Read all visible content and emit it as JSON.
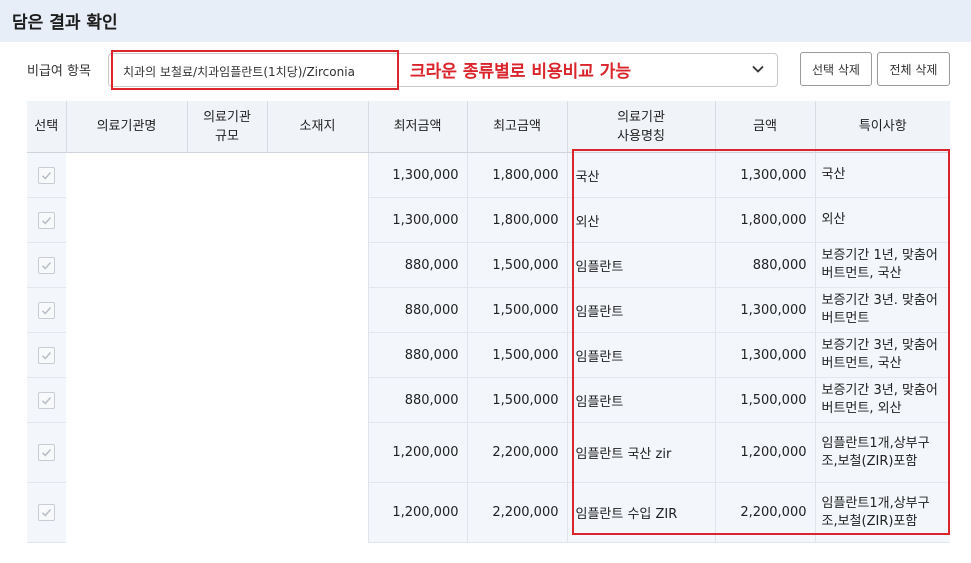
{
  "header": {
    "title": "담은 결과 확인"
  },
  "filter": {
    "label": "비급여 항목",
    "selected_value": "치과의 보철료/치과임플란트(1치당)/Zirconia",
    "annotation": "크라운 종류별로 비용비교 가능",
    "icon": "chevron-down-icon"
  },
  "buttons": {
    "delete_selected": "선택 삭제",
    "delete_all": "전체 삭제"
  },
  "table": {
    "headers": {
      "select": "선택",
      "institution": "의료기관명",
      "scale_1": "의료기관",
      "scale_2": "규모",
      "location": "소재지",
      "min_price": "최저금액",
      "max_price": "최고금액",
      "used_name_1": "의료기관",
      "used_name_2": "사용명칭",
      "price": "금액",
      "notes": "특이사항"
    },
    "rows": [
      {
        "min": "1,300,000",
        "max": "1,800,000",
        "name": "국산",
        "price": "1,300,000",
        "note": "국산",
        "checked": true
      },
      {
        "min": "1,300,000",
        "max": "1,800,000",
        "name": "외산",
        "price": "1,800,000",
        "note": "외산",
        "checked": true
      },
      {
        "min": "880,000",
        "max": "1,500,000",
        "name": "임플란트",
        "price": "880,000",
        "note": "보증기간 1년, 맞춤어버트먼트, 국산",
        "checked": true
      },
      {
        "min": "880,000",
        "max": "1,500,000",
        "name": "임플란트",
        "price": "1,300,000",
        "note": "보증기간 3년. 맞춤어버트먼트",
        "checked": true
      },
      {
        "min": "880,000",
        "max": "1,500,000",
        "name": "임플란트",
        "price": "1,300,000",
        "note": "보증기간 3년, 맞춤어버트먼트, 국산",
        "checked": true
      },
      {
        "min": "880,000",
        "max": "1,500,000",
        "name": "임플란트",
        "price": "1,500,000",
        "note": "보증기간 3년, 맞춤어버트먼트, 외산",
        "checked": true
      },
      {
        "min": "1,200,000",
        "max": "2,200,000",
        "name": "임플란트 국산 zir",
        "price": "1,200,000",
        "note": "임플란트1개,상부구조,보철(ZIR)포함",
        "checked": true
      },
      {
        "min": "1,200,000",
        "max": "2,200,000",
        "name": "임플란트 수입 ZIR",
        "price": "2,200,000",
        "note": "임플란트1개,상부구조,보철(ZIR)포함",
        "checked": true
      }
    ]
  },
  "colors": {
    "highlight": "#d9252b",
    "header_bg": "#e8eef8",
    "row_bg": "#f3f6fb"
  }
}
